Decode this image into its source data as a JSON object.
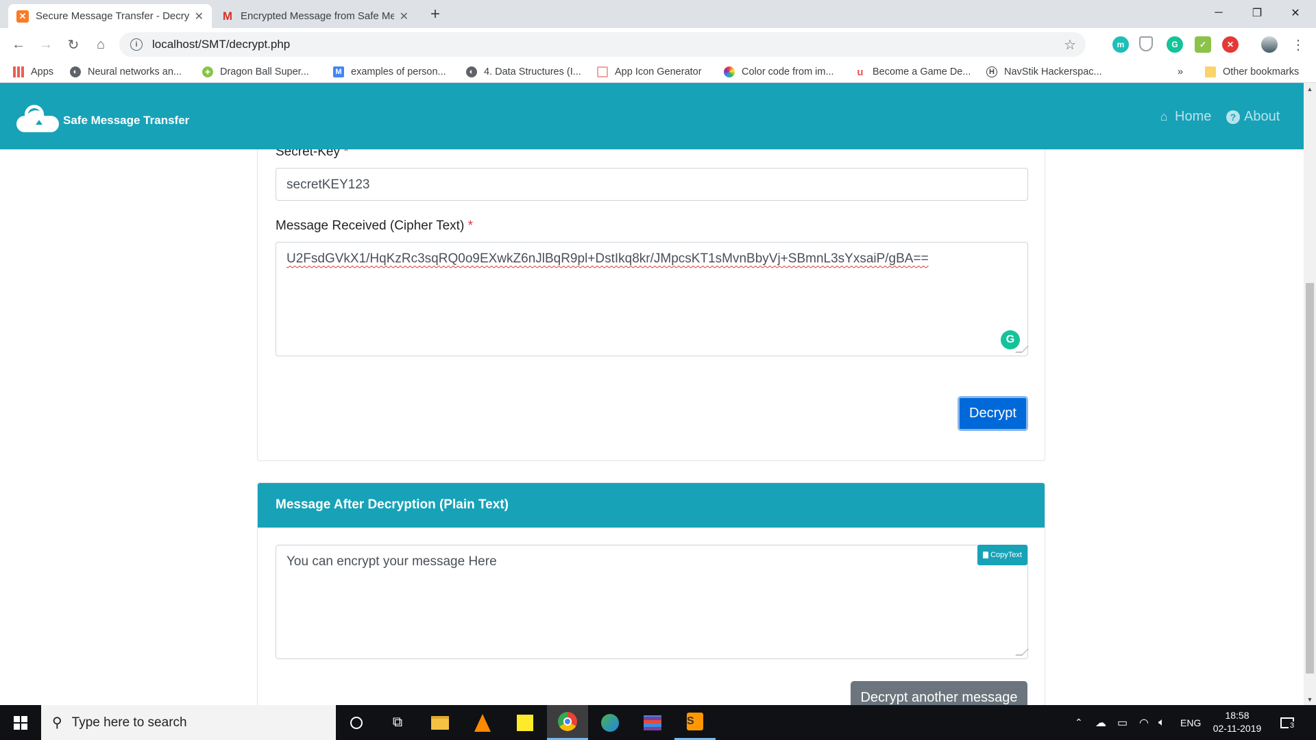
{
  "browser": {
    "tabs": [
      {
        "title": "Secure Message Transfer - Decry",
        "icon": "xampp-icon",
        "active": true
      },
      {
        "title": "Encrypted Message from Safe Me",
        "icon": "gmail-icon",
        "active": false
      }
    ],
    "url": "localhost/SMT/decrypt.php",
    "bookmarks": [
      {
        "label": "Apps",
        "icon": "apps-grid-icon"
      },
      {
        "label": "Neural networks an...",
        "icon": "globe-icon"
      },
      {
        "label": "Dragon Ball Super...",
        "icon": "dragon-icon"
      },
      {
        "label": "examples of person...",
        "icon": "medium-icon"
      },
      {
        "label": "4. Data Structures (I...",
        "icon": "globe-icon"
      },
      {
        "label": "App Icon Generator",
        "icon": "grid-icon"
      },
      {
        "label": "Color code from im...",
        "icon": "color-wheel-icon"
      },
      {
        "label": "Become a Game De...",
        "icon": "udemy-icon"
      },
      {
        "label": "NavStik Hackerspac...",
        "icon": "hex-icon"
      }
    ],
    "other_bookmarks": "Other bookmarks",
    "overflow": "»"
  },
  "site": {
    "brand": "Safe Message Transfer",
    "nav": [
      {
        "label": "Home",
        "icon": "home-icon"
      },
      {
        "label": "About",
        "icon": "question-circle-icon"
      }
    ]
  },
  "form": {
    "secret_key_label": "Secret-Key",
    "required_mark": "*",
    "secret_key_value": "secretKEY123",
    "cipher_label": "Message Received (Cipher Text)",
    "cipher_value": "U2FsdGVkX1/HqKzRc3sqRQ0o9EXwkZ6nJlBqR9pl+DstIkq8kr/JMpcsKT1sMvnBbyVj+SBmnL3sYxsaiP/gBA==",
    "decrypt_button": "Decrypt"
  },
  "result": {
    "header": "Message After Decryption (Plain Text)",
    "plain_text": "You can encrypt your message Here",
    "copy_button": "CopyText",
    "another_button": "Decrypt another message"
  },
  "taskbar": {
    "search_placeholder": "Type here to search",
    "language": "ENG",
    "time": "18:58",
    "date": "02-11-2019",
    "notifications": "3"
  },
  "colors": {
    "primary": "#17a2b8",
    "decrypt_button": "#0069d9",
    "secondary_button": "#6c757d"
  }
}
